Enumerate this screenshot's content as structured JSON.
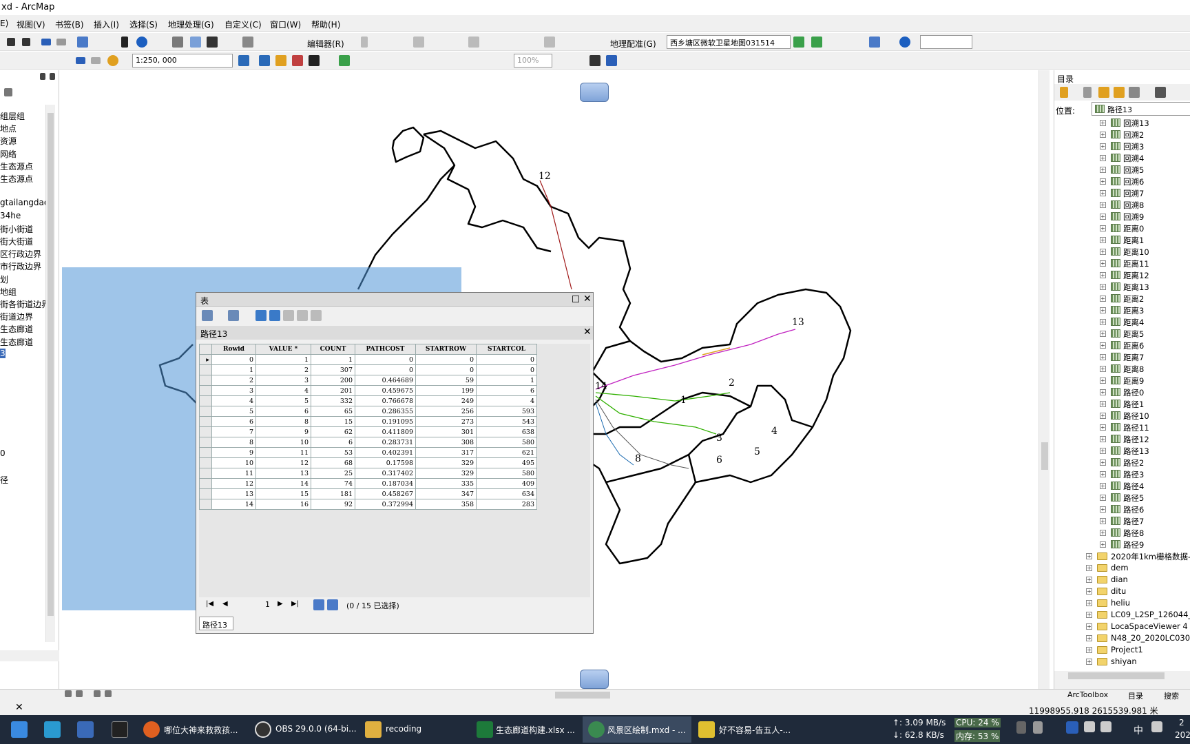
{
  "window": {
    "title": "xd - ArcMap"
  },
  "menu": [
    "E)",
    "视图(V)",
    "书签(B)",
    "插入(I)",
    "选择(S)",
    "地理处理(G)",
    "自定义(C)",
    "窗口(W)",
    "帮助(H)"
  ],
  "toolbar": {
    "editor_label": "编辑器(R)",
    "georef_label": "地理配准(G)",
    "georef_layer": "西乡塘区微软卫星地图031514",
    "scale": "1:250, 000",
    "zoom": "100%"
  },
  "toc": {
    "items": [
      "组层组",
      "地点",
      "资源",
      "网络",
      "生态源点",
      "生态源点",
      "",
      "gtailangdao",
      "34he",
      "街小街道",
      "街大街道",
      "区行政边界",
      "市行政边界",
      "划",
      "地组",
      "街各街道边界",
      "街道边界",
      "生态廊道",
      "生态廊道",
      "3",
      "",
      "",
      "",
      "",
      "",
      "",
      "",
      "0",
      "",
      "径",
      ""
    ]
  },
  "table": {
    "window_title": "表",
    "tab_title": "路径13",
    "columns": [
      "Rowid",
      "VALUE *",
      "COUNT",
      "PATHCOST",
      "STARTROW",
      "STARTCOL"
    ],
    "rows": [
      [
        "0",
        "1",
        "1",
        "0",
        "0",
        "0"
      ],
      [
        "1",
        "2",
        "307",
        "0",
        "0",
        "0"
      ],
      [
        "2",
        "3",
        "200",
        "0.464689",
        "59",
        "1"
      ],
      [
        "3",
        "4",
        "201",
        "0.459675",
        "199",
        "6"
      ],
      [
        "4",
        "5",
        "332",
        "0.766678",
        "249",
        "4"
      ],
      [
        "5",
        "6",
        "65",
        "0.286355",
        "256",
        "593"
      ],
      [
        "6",
        "8",
        "15",
        "0.191095",
        "273",
        "543"
      ],
      [
        "7",
        "9",
        "62",
        "0.411809",
        "301",
        "638"
      ],
      [
        "8",
        "10",
        "6",
        "0.283731",
        "308",
        "580"
      ],
      [
        "9",
        "11",
        "53",
        "0.402391",
        "317",
        "621"
      ],
      [
        "10",
        "12",
        "68",
        "0.17598",
        "329",
        "495"
      ],
      [
        "11",
        "13",
        "25",
        "0.317402",
        "329",
        "580"
      ],
      [
        "12",
        "14",
        "74",
        "0.187034",
        "335",
        "409"
      ],
      [
        "13",
        "15",
        "181",
        "0.458267",
        "347",
        "634"
      ],
      [
        "14",
        "16",
        "92",
        "0.372994",
        "358",
        "283"
      ]
    ],
    "record": "1",
    "selection": "(0 / 15 已选择)",
    "bottom_tab": "路径13"
  },
  "map": {
    "labels": [
      "12",
      "13",
      "2",
      "1",
      "14",
      "3",
      "4",
      "5",
      "6",
      "8"
    ]
  },
  "catalog": {
    "title": "目录",
    "location_label": "位置:",
    "location_value": "路径13",
    "rasters": [
      "回溯13",
      "回溯2",
      "回溯3",
      "回溯4",
      "回溯5",
      "回溯6",
      "回溯7",
      "回溯8",
      "回溯9",
      "距离0",
      "距离1",
      "距离10",
      "距离11",
      "距离12",
      "距离13",
      "距离2",
      "距离3",
      "距离4",
      "距离5",
      "距离6",
      "距离7",
      "距离8",
      "距离9",
      "路径0",
      "路径1",
      "路径10",
      "路径11",
      "路径12",
      "路径13",
      "路径2",
      "路径3",
      "路径4",
      "路径5",
      "路径6",
      "路径7",
      "路径8",
      "路径9"
    ],
    "folders": [
      "2020年1km栅格数据-",
      "dem",
      "dian",
      "ditu",
      "heliu",
      "LC09_L2SP_126044_2",
      "LocaSpaceViewer 4",
      "N48_20_2020LC030",
      "Project1",
      "shiyan"
    ],
    "tabs": [
      "ArcToolbox",
      "目录",
      "搜索"
    ]
  },
  "status": {
    "coords": "11998955.918  2615539.981 米"
  },
  "taskbar": {
    "items": [
      "哪位大神来救救孩...",
      "OBS 29.0.0 (64-bi...",
      "recoding",
      "生态廊道构建.xlsx ...",
      "风景区绘制.mxd - ...",
      "好不容易-告五人-..."
    ],
    "net_up": "↑: 3.09 MB/s",
    "net_down": "↓: 62.8 KB/s",
    "cpu": "CPU: 24 %",
    "mem": "内存: 53 %",
    "ime": "中",
    "clock_a": "2",
    "clock_b": "202"
  },
  "colors": {
    "selection": "#5096d7",
    "boundary": "#000000",
    "accent": "#3a6ab8"
  }
}
